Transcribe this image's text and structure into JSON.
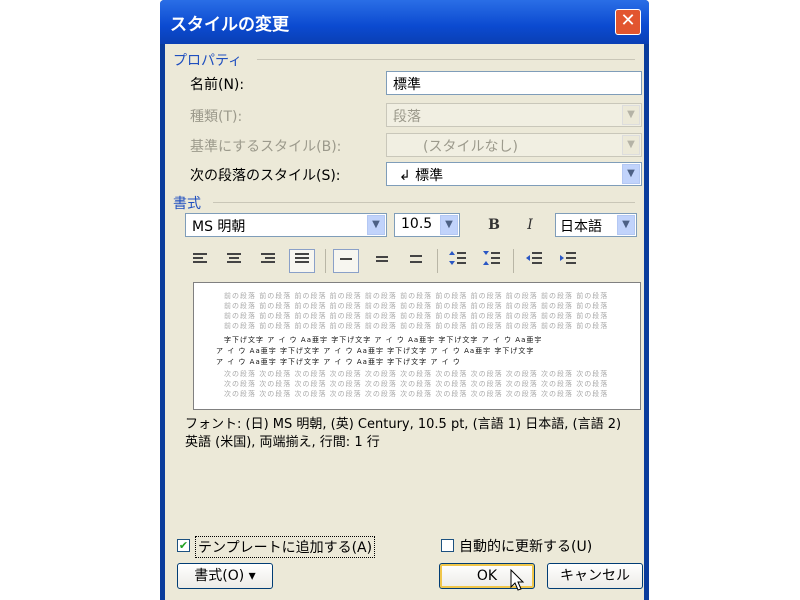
{
  "dialog": {
    "title": "スタイルの変更",
    "close_glyph": "✕"
  },
  "properties": {
    "group_label": "プロパティ",
    "name_label": "名前(N):",
    "name_value": "標準",
    "type_label": "種類(T):",
    "type_value": "段落",
    "based_on_label": "基準にするスタイル(B):",
    "based_on_value": "(スタイルなし)",
    "next_label": "次の段落のスタイル(S):",
    "next_value": "↲ 標準"
  },
  "format": {
    "group_label": "書式",
    "font_name": "MS 明朝",
    "font_size": "10.5",
    "bold_label": "B",
    "italic_label": "I",
    "language": "日本語"
  },
  "preview": {
    "gray_text": "前の段落 前の段落 前の段落 前の段落 前の段落 前の段落 前の段落 前の段落 前の段落 前の段落 前の段落",
    "sample_line_1": "字下げ文字 ア イ ウ Aa亜宇 字下げ文字 ア イ ウ Aa亜宇 字下げ文字 ア イ ウ Aa亜宇",
    "sample_line_2": "ア イ ウ Aa亜宇 字下げ文字 ア イ ウ Aa亜宇 字下げ文字 ア イ ウ Aa亜宇 字下げ文字",
    "sample_line_3": "ア イ ウ Aa亜宇 字下げ文字 ア イ ウ Aa亜宇 字下げ文字 ア イ ウ",
    "next_text": "次の段落 次の段落 次の段落 次の段落 次の段落 次の段落 次の段落 次の段落 次の段落 次の段落 次の段落"
  },
  "description": "フォント: (日) MS 明朝, (英) Century, 10.5 pt, (言語 1) 日本語, (言語 2) 英語 (米国), 両端揃え, 行間: 1 行",
  "footer": {
    "add_to_template_label": "テンプレートに追加する(A)",
    "add_to_template_checked": true,
    "auto_update_label": "自動的に更新する(U)",
    "auto_update_checked": false,
    "format_button_label": "書式(O) ▾",
    "ok_label": "OK",
    "cancel_label": "キャンセル"
  },
  "colors": {
    "title_bar": "#0b4ad0",
    "client_bg": "#ece9d8",
    "group_label": "#1f4fbf"
  }
}
